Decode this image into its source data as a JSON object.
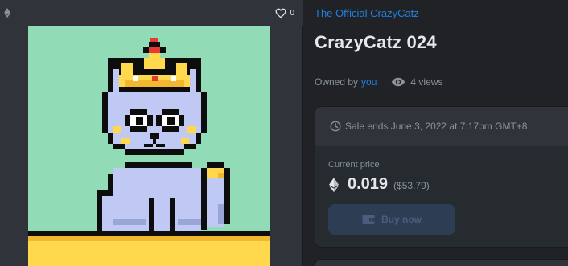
{
  "image_card": {
    "favorite_count": "0",
    "icons": {
      "chain": "ethereum-icon",
      "favorite": "heart-icon"
    }
  },
  "collection": {
    "name": "The Official CrazyCatz"
  },
  "item": {
    "title": "CrazyCatz 024"
  },
  "owner": {
    "prefix": "Owned by",
    "name": "you",
    "views": "4 views"
  },
  "sale": {
    "ends_text": "Sale ends June 3, 2022 at 7:17pm GMT+8",
    "price_label": "Current price",
    "price": "0.019",
    "price_usd": "($53.79)",
    "buy_label": "Buy now"
  },
  "colors": {
    "page_bg": "#202225",
    "card_bg": "#303339",
    "accent_link": "#2081e2",
    "buy_button_disabled": "#2d3d54",
    "art_bg": "#91dbb6",
    "art_floor": "#ffd84d"
  }
}
